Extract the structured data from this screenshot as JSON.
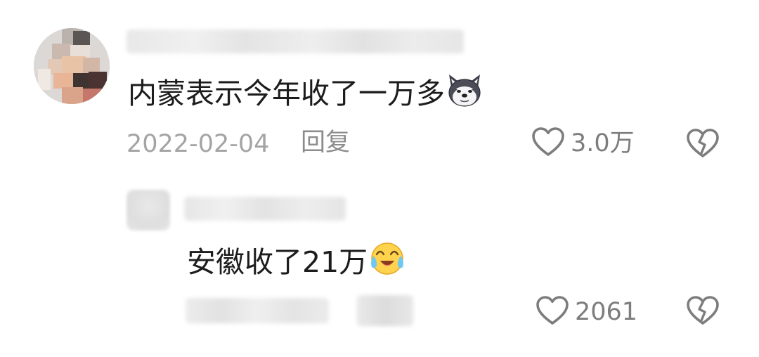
{
  "comment": {
    "text": "内蒙表示今年收了一万多",
    "emoji": "husky-dog-emoji",
    "date": "2022-02-04",
    "reply_label": "回复",
    "like_count": "3.0万"
  },
  "reply": {
    "text": "安徽收了21万",
    "emoji": "tears-of-joy-emoji",
    "like_count": "2061"
  },
  "colors": {
    "text": "#1c1c1c",
    "meta": "#a4a4a4",
    "icon": "#7d7d7d"
  }
}
